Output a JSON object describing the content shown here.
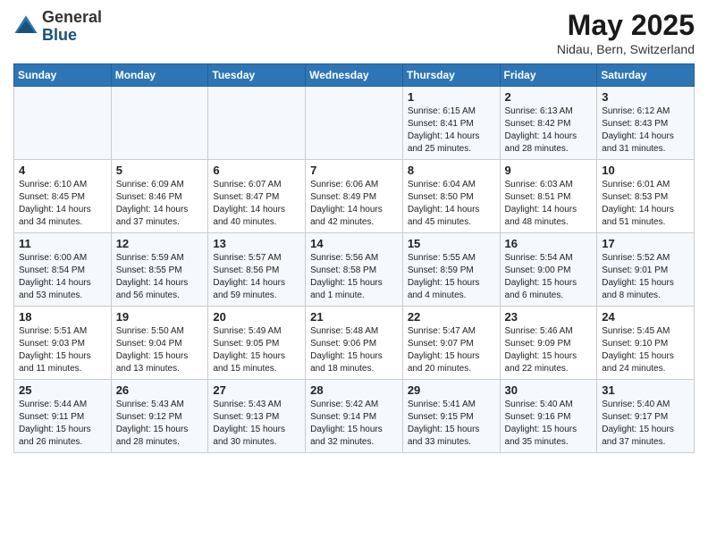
{
  "logo": {
    "general": "General",
    "blue": "Blue"
  },
  "title": {
    "month": "May 2025",
    "location": "Nidau, Bern, Switzerland"
  },
  "headers": [
    "Sunday",
    "Monday",
    "Tuesday",
    "Wednesday",
    "Thursday",
    "Friday",
    "Saturday"
  ],
  "weeks": [
    {
      "days": [
        {
          "num": "",
          "info": ""
        },
        {
          "num": "",
          "info": ""
        },
        {
          "num": "",
          "info": ""
        },
        {
          "num": "",
          "info": ""
        },
        {
          "num": "1",
          "info": "Sunrise: 6:15 AM\nSunset: 8:41 PM\nDaylight: 14 hours\nand 25 minutes."
        },
        {
          "num": "2",
          "info": "Sunrise: 6:13 AM\nSunset: 8:42 PM\nDaylight: 14 hours\nand 28 minutes."
        },
        {
          "num": "3",
          "info": "Sunrise: 6:12 AM\nSunset: 8:43 PM\nDaylight: 14 hours\nand 31 minutes."
        }
      ]
    },
    {
      "days": [
        {
          "num": "4",
          "info": "Sunrise: 6:10 AM\nSunset: 8:45 PM\nDaylight: 14 hours\nand 34 minutes."
        },
        {
          "num": "5",
          "info": "Sunrise: 6:09 AM\nSunset: 8:46 PM\nDaylight: 14 hours\nand 37 minutes."
        },
        {
          "num": "6",
          "info": "Sunrise: 6:07 AM\nSunset: 8:47 PM\nDaylight: 14 hours\nand 40 minutes."
        },
        {
          "num": "7",
          "info": "Sunrise: 6:06 AM\nSunset: 8:49 PM\nDaylight: 14 hours\nand 42 minutes."
        },
        {
          "num": "8",
          "info": "Sunrise: 6:04 AM\nSunset: 8:50 PM\nDaylight: 14 hours\nand 45 minutes."
        },
        {
          "num": "9",
          "info": "Sunrise: 6:03 AM\nSunset: 8:51 PM\nDaylight: 14 hours\nand 48 minutes."
        },
        {
          "num": "10",
          "info": "Sunrise: 6:01 AM\nSunset: 8:53 PM\nDaylight: 14 hours\nand 51 minutes."
        }
      ]
    },
    {
      "days": [
        {
          "num": "11",
          "info": "Sunrise: 6:00 AM\nSunset: 8:54 PM\nDaylight: 14 hours\nand 53 minutes."
        },
        {
          "num": "12",
          "info": "Sunrise: 5:59 AM\nSunset: 8:55 PM\nDaylight: 14 hours\nand 56 minutes."
        },
        {
          "num": "13",
          "info": "Sunrise: 5:57 AM\nSunset: 8:56 PM\nDaylight: 14 hours\nand 59 minutes."
        },
        {
          "num": "14",
          "info": "Sunrise: 5:56 AM\nSunset: 8:58 PM\nDaylight: 15 hours\nand 1 minute."
        },
        {
          "num": "15",
          "info": "Sunrise: 5:55 AM\nSunset: 8:59 PM\nDaylight: 15 hours\nand 4 minutes."
        },
        {
          "num": "16",
          "info": "Sunrise: 5:54 AM\nSunset: 9:00 PM\nDaylight: 15 hours\nand 6 minutes."
        },
        {
          "num": "17",
          "info": "Sunrise: 5:52 AM\nSunset: 9:01 PM\nDaylight: 15 hours\nand 8 minutes."
        }
      ]
    },
    {
      "days": [
        {
          "num": "18",
          "info": "Sunrise: 5:51 AM\nSunset: 9:03 PM\nDaylight: 15 hours\nand 11 minutes."
        },
        {
          "num": "19",
          "info": "Sunrise: 5:50 AM\nSunset: 9:04 PM\nDaylight: 15 hours\nand 13 minutes."
        },
        {
          "num": "20",
          "info": "Sunrise: 5:49 AM\nSunset: 9:05 PM\nDaylight: 15 hours\nand 15 minutes."
        },
        {
          "num": "21",
          "info": "Sunrise: 5:48 AM\nSunset: 9:06 PM\nDaylight: 15 hours\nand 18 minutes."
        },
        {
          "num": "22",
          "info": "Sunrise: 5:47 AM\nSunset: 9:07 PM\nDaylight: 15 hours\nand 20 minutes."
        },
        {
          "num": "23",
          "info": "Sunrise: 5:46 AM\nSunset: 9:09 PM\nDaylight: 15 hours\nand 22 minutes."
        },
        {
          "num": "24",
          "info": "Sunrise: 5:45 AM\nSunset: 9:10 PM\nDaylight: 15 hours\nand 24 minutes."
        }
      ]
    },
    {
      "days": [
        {
          "num": "25",
          "info": "Sunrise: 5:44 AM\nSunset: 9:11 PM\nDaylight: 15 hours\nand 26 minutes."
        },
        {
          "num": "26",
          "info": "Sunrise: 5:43 AM\nSunset: 9:12 PM\nDaylight: 15 hours\nand 28 minutes."
        },
        {
          "num": "27",
          "info": "Sunrise: 5:43 AM\nSunset: 9:13 PM\nDaylight: 15 hours\nand 30 minutes."
        },
        {
          "num": "28",
          "info": "Sunrise: 5:42 AM\nSunset: 9:14 PM\nDaylight: 15 hours\nand 32 minutes."
        },
        {
          "num": "29",
          "info": "Sunrise: 5:41 AM\nSunset: 9:15 PM\nDaylight: 15 hours\nand 33 minutes."
        },
        {
          "num": "30",
          "info": "Sunrise: 5:40 AM\nSunset: 9:16 PM\nDaylight: 15 hours\nand 35 minutes."
        },
        {
          "num": "31",
          "info": "Sunrise: 5:40 AM\nSunset: 9:17 PM\nDaylight: 15 hours\nand 37 minutes."
        }
      ]
    }
  ]
}
